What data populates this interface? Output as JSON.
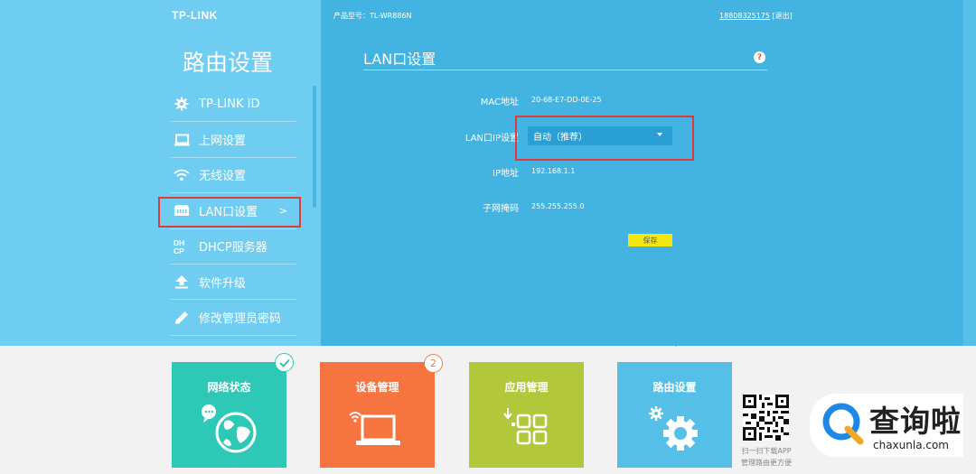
{
  "header": {
    "logo": "TP-LINK",
    "product_model": "产品型号：TL-WR886N",
    "phone": "18808325175",
    "logout": "[退出]"
  },
  "sidebar": {
    "title": "路由设置",
    "items": [
      {
        "label": "TP-LINK ID",
        "icon": "gear-icon"
      },
      {
        "label": "上网设置",
        "icon": "monitor-icon"
      },
      {
        "label": "无线设置",
        "icon": "wifi-icon"
      },
      {
        "label": "LAN口设置",
        "icon": "lan-port-icon",
        "active": true,
        "chevron": ">"
      },
      {
        "label": "DHCP服务器",
        "icon": "dhcp-icon",
        "icon_text": "DH CP"
      },
      {
        "label": "软件升级",
        "icon": "upload-icon"
      },
      {
        "label": "修改管理员密码",
        "icon": "pencil-icon"
      }
    ]
  },
  "content": {
    "title": "LAN口设置",
    "help": "?",
    "mac_label": "MAC地址",
    "mac_value": "20-68-E7-DD-0E-25",
    "ip_setting_label": "LAN口IP设置",
    "ip_setting_value": "自动（推荐）",
    "ip_label": "IP地址",
    "ip_value": "192.168.1.1",
    "mask_label": "子网掩码",
    "mask_value": "255.255.255.0",
    "save": "保存"
  },
  "tiles": [
    {
      "label": "网络状态",
      "color": "#2ec8b6",
      "icon": "globe-icon"
    },
    {
      "label": "设备管理",
      "color": "#f57440",
      "icon": "laptop-icon",
      "badge": "2"
    },
    {
      "label": "应用管理",
      "color": "#b2c83a",
      "icon": "apps-grid-icon"
    },
    {
      "label": "路由设置",
      "color": "#55bfe8",
      "icon": "gears-icon"
    }
  ],
  "qr_caption": [
    "扫一扫下载APP",
    "管理路由更方便"
  ],
  "watermark": {
    "text": "查询啦",
    "url": "chaxunla.com"
  }
}
